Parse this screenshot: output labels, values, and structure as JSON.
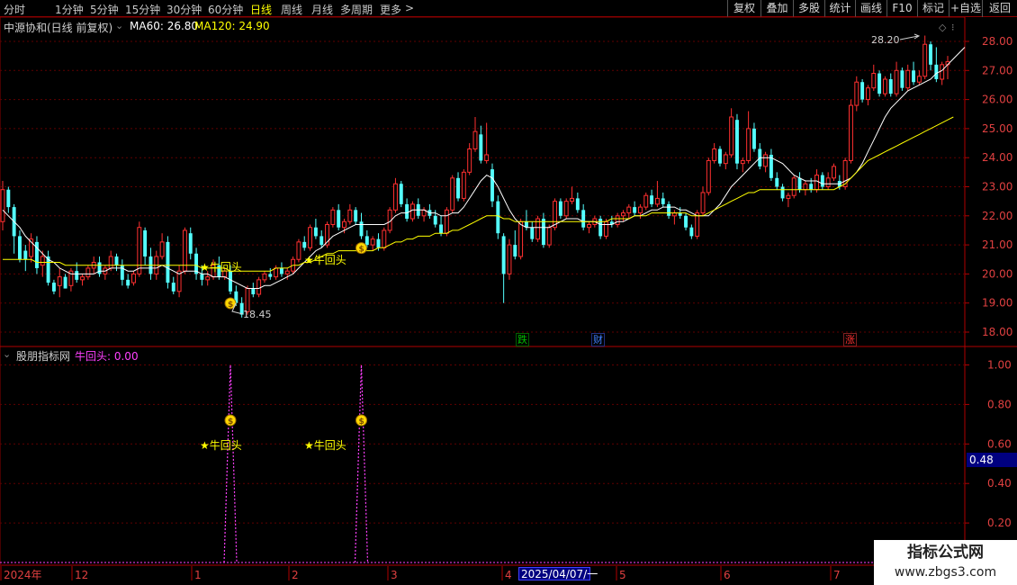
{
  "toolbar": {
    "periods": [
      "分时",
      "1分钟",
      "5分钟",
      "15分钟",
      "30分钟",
      "60分钟",
      "日线",
      "周线",
      "月线",
      "多周期",
      "更多"
    ],
    "active_period": "日线",
    "more_arrow": ">",
    "buttons": [
      "复权",
      "叠加",
      "多股",
      "统计",
      "画线",
      "F10",
      "标记",
      "+自选",
      "返回"
    ]
  },
  "main_chart": {
    "title": "中源协和(日线 前复权)",
    "ma_legend": [
      {
        "label": "MA60: 26.80",
        "color": "#ffffff"
      },
      {
        "label": "MA120: 24.90",
        "color": "#ffff00"
      }
    ],
    "high_annotation": "28.20",
    "low_annotation": "18.45",
    "y_ticks": [
      "28.00",
      "27.00",
      "26.00",
      "25.00",
      "24.00",
      "23.00",
      "22.00",
      "21.00",
      "20.00",
      "19.00",
      "18.00"
    ],
    "event_markers": [
      {
        "text": "跌",
        "color": "#00c000"
      },
      {
        "text": "财",
        "color": "#4080ff"
      },
      {
        "text": "涨",
        "color": "#ff3030"
      }
    ],
    "signal_label": "★牛回头",
    "signal_icon": "money-bag-icon"
  },
  "indicator": {
    "name": "股朋指标网",
    "series_label": "牛回头: 0.00",
    "y_ticks": [
      "1.00",
      "0.80",
      "0.60",
      "0.40",
      "0.20"
    ],
    "cursor_value": "0.48",
    "signal_label": "★牛回头"
  },
  "x_axis": {
    "labels": [
      "2024年",
      "12",
      "1",
      "2",
      "3",
      "4",
      "5",
      "6",
      "7"
    ],
    "cursor_date": "2025/04/07/一"
  },
  "watermark": {
    "title": "指标公式网",
    "url": "www.zbgs3.com"
  },
  "chart_data": {
    "type": "candlestick",
    "price_ylim": [
      18.0,
      28.0
    ],
    "indicator_ylim": [
      0.0,
      1.0
    ],
    "colors": {
      "up": "#ff3030",
      "down": "#54ffff",
      "ma60": "#ffffff",
      "ma120": "#ffff00",
      "signal": "#ff40ff"
    },
    "candles": [
      [
        21.8,
        23.2,
        21.5,
        22.9
      ],
      [
        22.9,
        23.0,
        22.1,
        22.3
      ],
      [
        22.3,
        22.4,
        20.7,
        21.3
      ],
      [
        21.3,
        21.5,
        20.4,
        20.5
      ],
      [
        20.8,
        21.0,
        20.1,
        20.5
      ],
      [
        20.6,
        21.4,
        20.4,
        21.2
      ],
      [
        21.1,
        21.3,
        20.0,
        20.2
      ],
      [
        20.3,
        20.8,
        19.9,
        20.6
      ],
      [
        20.6,
        20.8,
        19.6,
        19.7
      ],
      [
        19.7,
        19.8,
        19.3,
        19.4
      ],
      [
        19.6,
        20.2,
        19.2,
        19.9
      ],
      [
        19.9,
        20.0,
        19.5,
        19.5
      ],
      [
        19.6,
        20.2,
        19.4,
        20.1
      ],
      [
        20.1,
        20.4,
        19.7,
        19.8
      ],
      [
        19.8,
        20.0,
        19.6,
        19.9
      ],
      [
        19.9,
        20.3,
        19.8,
        20.2
      ],
      [
        20.2,
        20.6,
        20.0,
        20.4
      ],
      [
        20.4,
        20.6,
        19.9,
        20.0
      ],
      [
        20.0,
        20.3,
        19.8,
        20.2
      ],
      [
        20.2,
        20.8,
        20.1,
        20.6
      ],
      [
        20.6,
        20.7,
        20.1,
        20.3
      ],
      [
        20.3,
        20.5,
        19.6,
        19.8
      ],
      [
        19.8,
        20.0,
        19.5,
        19.6
      ],
      [
        19.7,
        20.1,
        19.6,
        20.0
      ],
      [
        20.0,
        21.8,
        19.9,
        21.6
      ],
      [
        21.5,
        21.6,
        20.3,
        20.6
      ],
      [
        20.6,
        20.9,
        19.8,
        20.0
      ],
      [
        20.0,
        20.8,
        19.8,
        20.6
      ],
      [
        20.6,
        21.4,
        20.5,
        21.1
      ],
      [
        21.1,
        21.3,
        19.5,
        19.7
      ],
      [
        19.7,
        19.9,
        19.3,
        19.4
      ],
      [
        19.4,
        20.3,
        19.2,
        20.1
      ],
      [
        20.1,
        21.6,
        20.0,
        21.5
      ],
      [
        21.4,
        21.6,
        20.5,
        20.7
      ],
      [
        20.7,
        20.9,
        19.8,
        20.0
      ],
      [
        20.0,
        20.3,
        19.6,
        19.8
      ],
      [
        19.8,
        20.1,
        19.6,
        19.9
      ],
      [
        19.9,
        20.5,
        19.8,
        20.3
      ],
      [
        20.3,
        20.6,
        19.8,
        19.9
      ],
      [
        19.9,
        20.2,
        19.8,
        20.1
      ],
      [
        20.1,
        20.3,
        19.3,
        19.4
      ],
      [
        19.4,
        19.6,
        18.9,
        19.0
      ],
      [
        19.0,
        19.2,
        18.5,
        18.6
      ],
      [
        18.7,
        19.6,
        18.6,
        19.5
      ],
      [
        19.5,
        19.7,
        19.2,
        19.3
      ],
      [
        19.3,
        19.9,
        19.2,
        19.8
      ],
      [
        19.8,
        20.1,
        19.7,
        20.0
      ],
      [
        20.0,
        20.2,
        19.8,
        19.9
      ],
      [
        19.9,
        20.3,
        19.8,
        20.2
      ],
      [
        20.2,
        20.4,
        19.9,
        20.0
      ],
      [
        20.0,
        20.2,
        19.8,
        20.1
      ],
      [
        20.1,
        20.6,
        20.0,
        20.5
      ],
      [
        20.5,
        21.2,
        20.4,
        21.1
      ],
      [
        21.1,
        21.3,
        20.8,
        20.9
      ],
      [
        20.9,
        21.7,
        20.8,
        21.6
      ],
      [
        21.6,
        21.9,
        21.2,
        21.3
      ],
      [
        21.3,
        21.5,
        20.9,
        21.0
      ],
      [
        21.0,
        21.8,
        20.9,
        21.7
      ],
      [
        21.7,
        22.3,
        21.6,
        22.2
      ],
      [
        22.2,
        22.4,
        21.5,
        21.6
      ],
      [
        21.6,
        21.9,
        21.4,
        21.8
      ],
      [
        21.8,
        22.4,
        21.7,
        22.2
      ],
      [
        22.2,
        22.3,
        21.7,
        21.8
      ],
      [
        21.8,
        22.1,
        21.2,
        21.3
      ],
      [
        21.3,
        21.5,
        20.9,
        21.0
      ],
      [
        21.0,
        21.3,
        20.8,
        21.2
      ],
      [
        21.2,
        21.4,
        20.8,
        20.9
      ],
      [
        20.9,
        21.6,
        20.8,
        21.5
      ],
      [
        21.5,
        22.3,
        21.4,
        22.2
      ],
      [
        22.2,
        23.3,
        22.1,
        23.1
      ],
      [
        23.1,
        23.2,
        22.3,
        22.4
      ],
      [
        22.4,
        22.6,
        21.8,
        21.9
      ],
      [
        21.9,
        22.5,
        21.8,
        22.4
      ],
      [
        22.4,
        22.6,
        21.9,
        22.0
      ],
      [
        22.0,
        22.3,
        21.8,
        22.2
      ],
      [
        22.2,
        22.4,
        21.9,
        22.0
      ],
      [
        22.0,
        22.2,
        21.6,
        21.7
      ],
      [
        21.7,
        22.0,
        21.3,
        21.4
      ],
      [
        21.4,
        22.3,
        21.3,
        22.2
      ],
      [
        22.2,
        23.4,
        22.1,
        23.3
      ],
      [
        23.3,
        23.5,
        22.5,
        22.6
      ],
      [
        22.6,
        23.6,
        22.5,
        23.5
      ],
      [
        23.5,
        24.5,
        23.4,
        24.3
      ],
      [
        24.3,
        25.4,
        24.2,
        24.9
      ],
      [
        24.8,
        25.1,
        23.8,
        23.9
      ],
      [
        23.9,
        25.2,
        23.8,
        24.1
      ],
      [
        23.6,
        23.8,
        22.3,
        22.5
      ],
      [
        22.5,
        22.7,
        21.2,
        21.4
      ],
      [
        21.3,
        21.4,
        19.0,
        20.0
      ],
      [
        20.0,
        21.2,
        19.8,
        21.0
      ],
      [
        21.0,
        21.5,
        20.5,
        20.6
      ],
      [
        20.6,
        21.9,
        20.5,
        21.8
      ],
      [
        21.8,
        22.2,
        21.5,
        21.6
      ],
      [
        21.6,
        21.8,
        21.1,
        21.2
      ],
      [
        21.2,
        22.0,
        21.1,
        21.9
      ],
      [
        21.9,
        22.1,
        20.9,
        21.0
      ],
      [
        21.0,
        21.7,
        20.9,
        21.6
      ],
      [
        21.6,
        22.6,
        21.5,
        22.5
      ],
      [
        22.5,
        22.6,
        21.9,
        22.0
      ],
      [
        22.0,
        22.6,
        21.9,
        22.5
      ],
      [
        22.5,
        23.0,
        22.4,
        22.6
      ],
      [
        22.6,
        22.8,
        22.1,
        22.2
      ],
      [
        22.2,
        22.4,
        21.5,
        21.6
      ],
      [
        21.6,
        21.8,
        21.4,
        21.7
      ],
      [
        21.7,
        22.0,
        21.6,
        21.9
      ],
      [
        21.9,
        22.0,
        21.2,
        21.3
      ],
      [
        21.3,
        21.9,
        21.2,
        21.8
      ],
      [
        21.8,
        22.0,
        21.6,
        21.7
      ],
      [
        21.7,
        22.1,
        21.6,
        22.0
      ],
      [
        22.0,
        22.2,
        21.8,
        22.1
      ],
      [
        22.1,
        22.4,
        21.9,
        22.3
      ],
      [
        22.3,
        22.5,
        22.0,
        22.1
      ],
      [
        22.1,
        22.4,
        21.9,
        22.3
      ],
      [
        22.3,
        22.8,
        22.2,
        22.7
      ],
      [
        22.7,
        22.9,
        22.3,
        22.4
      ],
      [
        22.4,
        23.2,
        22.3,
        22.6
      ],
      [
        22.6,
        22.8,
        22.3,
        22.4
      ],
      [
        22.4,
        22.5,
        21.9,
        22.0
      ],
      [
        22.0,
        22.2,
        21.7,
        22.1
      ],
      [
        22.1,
        22.3,
        21.9,
        22.0
      ],
      [
        22.0,
        22.1,
        21.5,
        21.6
      ],
      [
        21.6,
        21.7,
        21.2,
        21.3
      ],
      [
        21.3,
        22.2,
        21.2,
        22.1
      ],
      [
        22.1,
        23.0,
        22.0,
        22.8
      ],
      [
        22.8,
        24.0,
        22.7,
        23.9
      ],
      [
        23.9,
        24.5,
        23.8,
        24.3
      ],
      [
        24.3,
        24.4,
        23.7,
        23.8
      ],
      [
        23.8,
        24.2,
        23.6,
        24.1
      ],
      [
        24.1,
        25.7,
        24.0,
        25.4
      ],
      [
        25.3,
        25.5,
        23.6,
        23.8
      ],
      [
        23.8,
        24.0,
        23.5,
        23.9
      ],
      [
        23.9,
        25.6,
        23.8,
        25.0
      ],
      [
        25.0,
        25.2,
        24.2,
        24.3
      ],
      [
        24.3,
        24.5,
        23.6,
        23.7
      ],
      [
        23.7,
        24.2,
        23.5,
        24.1
      ],
      [
        24.1,
        24.3,
        23.2,
        23.3
      ],
      [
        23.3,
        23.5,
        22.9,
        23.0
      ],
      [
        23.0,
        23.1,
        22.5,
        22.6
      ],
      [
        22.6,
        22.8,
        22.3,
        22.7
      ],
      [
        22.7,
        23.4,
        22.6,
        23.3
      ],
      [
        23.3,
        23.5,
        22.8,
        22.9
      ],
      [
        22.9,
        23.2,
        22.7,
        23.1
      ],
      [
        23.1,
        23.3,
        22.8,
        22.9
      ],
      [
        22.9,
        23.6,
        22.8,
        23.4
      ],
      [
        23.4,
        23.5,
        22.9,
        23.0
      ],
      [
        23.0,
        23.5,
        22.9,
        23.3
      ],
      [
        23.3,
        23.8,
        23.2,
        23.7
      ],
      [
        23.2,
        23.4,
        22.9,
        23.0
      ],
      [
        23.0,
        24.0,
        22.9,
        23.9
      ],
      [
        23.9,
        26.0,
        23.8,
        25.8
      ],
      [
        25.8,
        26.8,
        25.6,
        26.6
      ],
      [
        26.6,
        26.7,
        25.9,
        26.0
      ],
      [
        26.0,
        26.5,
        25.8,
        26.4
      ],
      [
        26.4,
        27.2,
        26.3,
        26.9
      ],
      [
        26.9,
        27.0,
        26.1,
        26.2
      ],
      [
        26.2,
        26.8,
        26.1,
        26.7
      ],
      [
        26.7,
        26.9,
        26.1,
        26.2
      ],
      [
        26.2,
        27.3,
        26.1,
        27.0
      ],
      [
        27.0,
        27.1,
        26.3,
        26.4
      ],
      [
        26.4,
        27.2,
        26.3,
        27.0
      ],
      [
        27.0,
        27.3,
        26.5,
        26.6
      ],
      [
        26.6,
        27.0,
        26.5,
        26.8
      ],
      [
        26.8,
        28.2,
        26.7,
        27.9
      ],
      [
        27.9,
        28.0,
        27.0,
        27.2
      ],
      [
        27.2,
        27.8,
        26.6,
        26.7
      ],
      [
        26.7,
        27.3,
        26.5,
        27.2
      ],
      [
        27.2,
        27.5,
        26.7,
        27.3
      ]
    ],
    "ma60": [
      22.2,
      22.0,
      21.8,
      21.6,
      21.3,
      21.1,
      20.9,
      20.7,
      20.5,
      20.4,
      20.2,
      20.1,
      20.0,
      20.0,
      20.0,
      20.0,
      20.0,
      20.1,
      20.1,
      20.2,
      20.2,
      20.2,
      20.1,
      20.1,
      20.2,
      20.2,
      20.2,
      20.2,
      20.3,
      20.2,
      20.1,
      20.0,
      20.1,
      20.1,
      20.1,
      20.0,
      20.0,
      19.9,
      19.9,
      19.9,
      19.8,
      19.7,
      19.6,
      19.5,
      19.5,
      19.5,
      19.6,
      19.6,
      19.7,
      19.8,
      19.9,
      20.0,
      20.2,
      20.4,
      20.6,
      20.8,
      20.9,
      21.1,
      21.3,
      21.4,
      21.5,
      21.6,
      21.7,
      21.7,
      21.7,
      21.7,
      21.7,
      21.7,
      21.8,
      22.0,
      22.1,
      22.1,
      22.2,
      22.2,
      22.2,
      22.1,
      22.1,
      22.0,
      22.0,
      22.1,
      22.1,
      22.3,
      22.6,
      22.9,
      23.2,
      23.4,
      23.3,
      23.0,
      22.6,
      22.2,
      21.9,
      21.7,
      21.6,
      21.6,
      21.6,
      21.6,
      21.6,
      21.7,
      21.8,
      21.9,
      21.9,
      21.9,
      21.8,
      21.8,
      21.8,
      21.7,
      21.7,
      21.7,
      21.8,
      21.8,
      21.9,
      22.0,
      22.0,
      22.1,
      22.2,
      22.2,
      22.3,
      22.3,
      22.3,
      22.2,
      22.2,
      22.1,
      22.0,
      22.0,
      22.0,
      22.2,
      22.4,
      22.7,
      23.0,
      23.2,
      23.4,
      23.6,
      23.8,
      24.0,
      24.0,
      24.0,
      23.9,
      23.8,
      23.6,
      23.4,
      23.3,
      23.2,
      23.2,
      23.2,
      23.1,
      23.1,
      23.1,
      23.1,
      23.2,
      23.3,
      23.5,
      23.8,
      24.2,
      24.6,
      25.0,
      25.4,
      25.7,
      25.9,
      26.1,
      26.3,
      26.4,
      26.5,
      26.6,
      26.7,
      26.9,
      27.0,
      27.2,
      27.4,
      27.6,
      27.8
    ],
    "ma120": [
      20.5,
      20.5,
      20.5,
      20.5,
      20.5,
      20.5,
      20.4,
      20.4,
      20.4,
      20.4,
      20.4,
      20.3,
      20.3,
      20.3,
      20.3,
      20.3,
      20.3,
      20.3,
      20.3,
      20.3,
      20.3,
      20.3,
      20.3,
      20.3,
      20.3,
      20.3,
      20.3,
      20.3,
      20.3,
      20.3,
      20.3,
      20.3,
      20.3,
      20.3,
      20.3,
      20.2,
      20.2,
      20.2,
      20.2,
      20.2,
      20.1,
      20.1,
      20.1,
      20.1,
      20.1,
      20.1,
      20.1,
      20.1,
      20.2,
      20.2,
      20.2,
      20.3,
      20.3,
      20.4,
      20.4,
      20.5,
      20.6,
      20.7,
      20.7,
      20.8,
      20.8,
      20.8,
      20.8,
      20.8,
      20.8,
      20.8,
      20.9,
      20.9,
      21.0,
      21.1,
      21.1,
      21.2,
      21.2,
      21.3,
      21.3,
      21.3,
      21.4,
      21.4,
      21.4,
      21.5,
      21.5,
      21.6,
      21.7,
      21.8,
      21.9,
      22.0,
      22.0,
      22.0,
      21.9,
      21.9,
      21.8,
      21.8,
      21.8,
      21.8,
      21.8,
      21.8,
      21.8,
      21.8,
      21.8,
      21.8,
      21.8,
      21.8,
      21.8,
      21.8,
      21.8,
      21.8,
      21.8,
      21.9,
      21.9,
      21.9,
      21.9,
      22.0,
      22.0,
      22.0,
      22.1,
      22.1,
      22.1,
      22.1,
      22.1,
      22.1,
      22.1,
      22.0,
      22.0,
      22.0,
      22.1,
      22.2,
      22.3,
      22.4,
      22.5,
      22.6,
      22.7,
      22.8,
      22.8,
      22.9,
      22.9,
      22.9,
      22.9,
      22.9,
      22.9,
      22.9,
      22.9,
      22.9,
      22.9,
      22.9,
      22.9,
      22.9,
      22.9,
      23.0,
      23.1,
      23.3,
      23.5,
      23.7,
      23.9,
      24.0,
      24.1,
      24.2,
      24.3,
      24.4,
      24.5,
      24.6,
      24.7,
      24.8,
      24.9,
      25.0,
      25.1,
      25.2,
      25.3,
      25.4
    ],
    "signal_indices": [
      40,
      63
    ],
    "signal_values": [
      1.0,
      1.0
    ]
  }
}
